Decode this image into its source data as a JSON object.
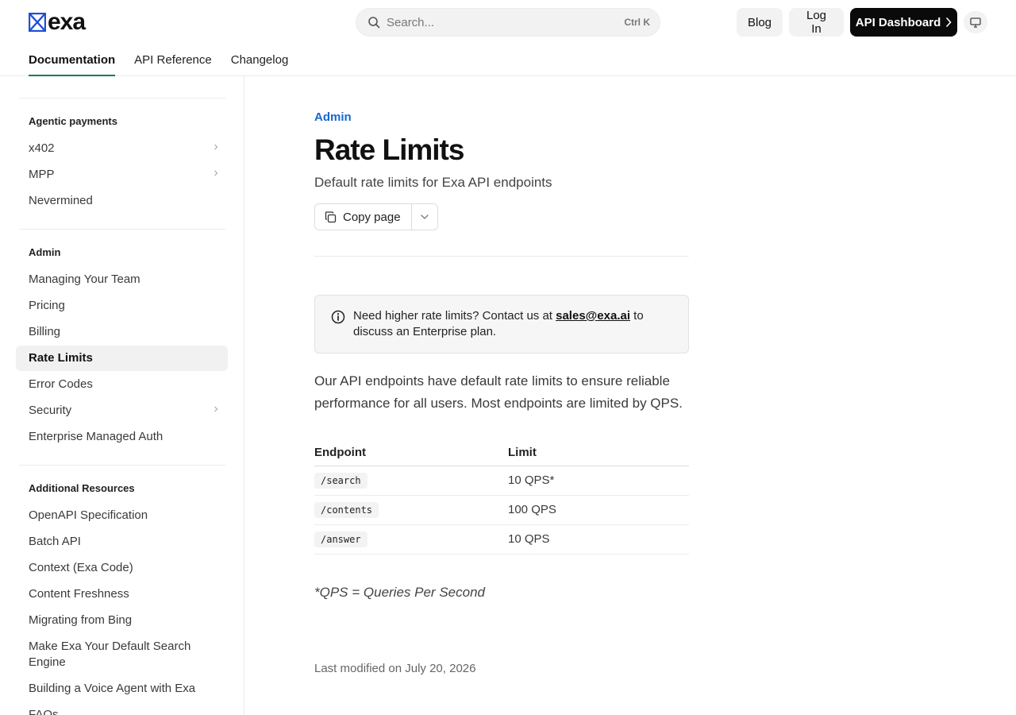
{
  "header": {
    "logo_text": "exa",
    "search_placeholder": "Search...",
    "search_shortcut": "Ctrl K",
    "blog_label": "Blog",
    "login_label": "Log In",
    "dashboard_label": "API Dashboard",
    "tabs": [
      {
        "label": "Documentation",
        "active": true
      },
      {
        "label": "API Reference",
        "active": false
      },
      {
        "label": "Changelog",
        "active": false
      }
    ]
  },
  "sidebar": {
    "sections": [
      {
        "heading": "Agentic payments",
        "items": [
          {
            "label": "x402",
            "expandable": true
          },
          {
            "label": "MPP",
            "expandable": true
          },
          {
            "label": "Nevermined",
            "expandable": false
          }
        ]
      },
      {
        "heading": "Admin",
        "items": [
          {
            "label": "Managing Your Team",
            "expandable": false
          },
          {
            "label": "Pricing",
            "expandable": false
          },
          {
            "label": "Billing",
            "expandable": false
          },
          {
            "label": "Rate Limits",
            "expandable": false,
            "active": true
          },
          {
            "label": "Error Codes",
            "expandable": false
          },
          {
            "label": "Security",
            "expandable": true
          },
          {
            "label": "Enterprise Managed Auth",
            "expandable": false
          }
        ]
      },
      {
        "heading": "Additional Resources",
        "items": [
          {
            "label": "OpenAPI Specification",
            "expandable": false
          },
          {
            "label": "Batch API",
            "expandable": false
          },
          {
            "label": "Context (Exa Code)",
            "expandable": false
          },
          {
            "label": "Content Freshness",
            "expandable": false
          },
          {
            "label": "Migrating from Bing",
            "expandable": false
          },
          {
            "label": "Make Exa Your Default Search Engine",
            "expandable": false
          },
          {
            "label": "Building a Voice Agent with Exa",
            "expandable": false
          },
          {
            "label": "FAQs",
            "expandable": false
          }
        ]
      }
    ]
  },
  "page": {
    "eyebrow": "Admin",
    "title": "Rate Limits",
    "subtitle": "Default rate limits for Exa API endpoints",
    "copy_label": "Copy page",
    "callout": {
      "text_before": "Need higher rate limits? Contact us at ",
      "link": "sales@exa.ai",
      "text_after": " to discuss an Enterprise plan."
    },
    "intro": "Our API endpoints have default rate limits to ensure reliable performance for all users. Most endpoints are limited by QPS.",
    "table": {
      "headers": [
        "Endpoint",
        "Limit"
      ],
      "rows": [
        {
          "endpoint": "/search",
          "limit": "10 QPS*"
        },
        {
          "endpoint": "/contents",
          "limit": "100 QPS"
        },
        {
          "endpoint": "/answer",
          "limit": "10 QPS"
        }
      ]
    },
    "footnote": "*QPS = Queries Per Second",
    "last_modified": "Last modified on July 20, 2026"
  },
  "colors": {
    "accent_link": "#1866d1",
    "tab_underline": "#1a7a5a",
    "logo_blue": "#1f4fd6"
  }
}
